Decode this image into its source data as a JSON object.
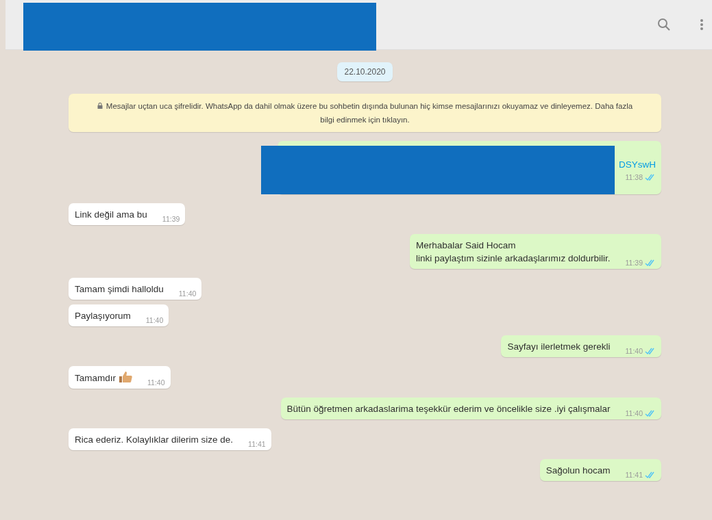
{
  "header": {
    "redacted": true
  },
  "date_chip": "22.10.2020",
  "notice": {
    "text": "Mesajlar uçtan uca şifrelidir. WhatsApp da dahil olmak üzere bu sohbetin dışında bulunan hiç kimse mesajlarınızı okuyamaz ve dinleyemez. Daha fazla bilgi edinmek için tıklayın."
  },
  "messages": [
    {
      "kind": "out",
      "lines": [
        "DSYswH"
      ],
      "link": true,
      "redacted": true,
      "time": "11:38",
      "read": true
    },
    {
      "kind": "in",
      "lines": [
        "Link değil ama bu"
      ],
      "time": "11:39"
    },
    {
      "kind": "out",
      "lines": [
        "Merhabalar Said Hocam",
        "linki paylaştım sizinle arkadaşlarımız doldurbilir."
      ],
      "time": "11:39",
      "read": true
    },
    {
      "kind": "in",
      "lines": [
        "Tamam şimdi halloldu"
      ],
      "time": "11:40"
    },
    {
      "kind": "in",
      "lines": [
        "Paylaşıyorum"
      ],
      "time": "11:40"
    },
    {
      "kind": "out",
      "lines": [
        "Sayfayı ilerletmek gerekli"
      ],
      "time": "11:40",
      "read": true
    },
    {
      "kind": "in",
      "lines": [
        "Tamamdır"
      ],
      "thumbs_up": true,
      "time": "11:40"
    },
    {
      "kind": "out",
      "lines": [
        "Bütün öğretmen arkadaslarima teşekkür ederim ve öncelikle size .iyi çalışmalar"
      ],
      "time": "11:40",
      "read": true
    },
    {
      "kind": "in",
      "lines": [
        "Rica ederiz. Kolaylıklar dilerim size de."
      ],
      "time": "11:41"
    },
    {
      "kind": "out",
      "lines": [
        "Sağolun hocam"
      ],
      "time": "11:41",
      "read": true
    }
  ]
}
